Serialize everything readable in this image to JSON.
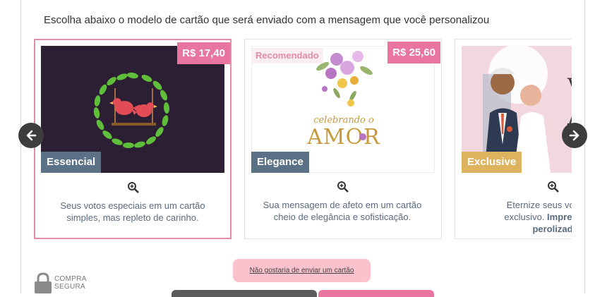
{
  "intro_text": "Escolha abaixo o modelo de cartão que será enviado com a mensagem que você personalizou",
  "cards": [
    {
      "tier": "Essencial",
      "price": "R$ 17,40",
      "description_lines": [
        "Seus votos especiais em um cartão",
        "simples, mas repleto de carinho."
      ],
      "selected": true
    },
    {
      "tier": "Elegance",
      "price": "R$ 25,60",
      "badge": "Recomendado",
      "image_text": [
        "celebrando o",
        "AMOR"
      ],
      "description_lines": [
        "Sua mensagem de afeto em um cartão",
        "cheio de elegância e sofisticação."
      ]
    },
    {
      "tier": "Exclusive",
      "description_line1": "Eternize seus votos co",
      "description_line2_plain": "exclusivo. ",
      "description_line2_bold": "Impresso en",
      "description_line3_bold": "perolizad"
    }
  ],
  "decline_label": "Não gostaria de enviar um cartão",
  "secure_lines": [
    "COMPRA",
    "SEGURA"
  ],
  "colors": {
    "accent_pink": "#e8759f",
    "selected_border": "#e48ba8",
    "tier_essencial": "#5b7185",
    "tier_elegance": "#5b7185",
    "tier_exclusive": "#ddb35f"
  },
  "icons": [
    "arrow-left-icon",
    "arrow-right-icon",
    "zoom-icon",
    "lock-icon"
  ]
}
